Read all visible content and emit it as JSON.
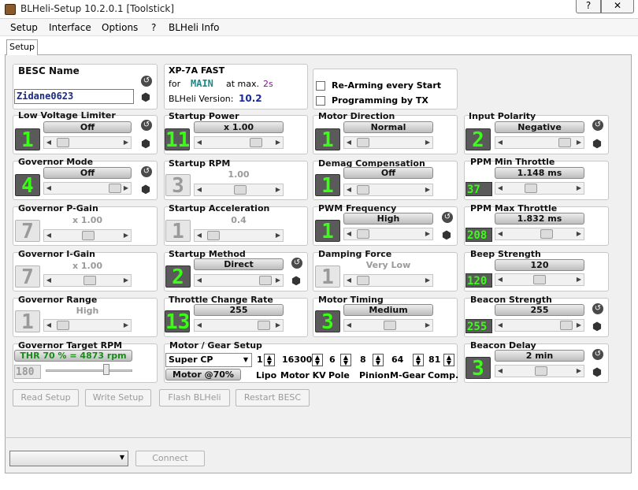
{
  "window": {
    "title": "BLHeli-Setup 10.2.0.1 [Toolstick]",
    "help": "?",
    "close": "✕"
  },
  "menu": [
    "Setup",
    "Interface",
    "Options",
    "?",
    "BLHeli Info"
  ],
  "tab": "Setup",
  "besc": {
    "label": "BESC Name",
    "value": "Zidane0623"
  },
  "info": {
    "line1": "XP-7A FAST",
    "for": "for",
    "main": "MAIN",
    "atmax": "at max.",
    "maxval": "2s",
    "version_label": "BLHeli Version:",
    "version": "10.2"
  },
  "rearm": {
    "label": "Re-Arming every Start"
  },
  "progtx": {
    "label": "Programming by TX"
  },
  "params": {
    "low_voltage": {
      "label": "Low Voltage Limiter",
      "num": "1",
      "value": "Off"
    },
    "startup_power": {
      "label": "Startup Power",
      "num": "11",
      "value": "x 1.00"
    },
    "motor_direction": {
      "label": "Motor Direction",
      "num": "1",
      "value": "Normal"
    },
    "input_polarity": {
      "label": "Input Polarity",
      "num": "2",
      "value": "Negative"
    },
    "governor_mode": {
      "label": "Governor Mode",
      "num": "4",
      "value": "Off"
    },
    "startup_rpm": {
      "label": "Startup RPM",
      "num": "3",
      "value": "1.00"
    },
    "demag": {
      "label": "Demag Compensation",
      "num": "1",
      "value": "Off"
    },
    "ppm_min": {
      "label": "PPM Min Throttle",
      "num": "37",
      "value": "1.148 ms"
    },
    "gov_p": {
      "label": "Governor P-Gain",
      "num": "7",
      "value": "x 1.00"
    },
    "startup_accel": {
      "label": "Startup Acceleration",
      "num": "1",
      "value": "0.4"
    },
    "pwm_freq": {
      "label": "PWM Frequency",
      "num": "1",
      "value": "High"
    },
    "ppm_max": {
      "label": "PPM Max Throttle",
      "num": "208",
      "value": "1.832 ms"
    },
    "gov_i": {
      "label": "Governor I-Gain",
      "num": "7",
      "value": "x 1.00"
    },
    "startup_method": {
      "label": "Startup Method",
      "num": "2",
      "value": "Direct"
    },
    "damping": {
      "label": "Damping Force",
      "num": "1",
      "value": "Very Low"
    },
    "beep": {
      "label": "Beep Strength",
      "num": "120",
      "value": "120"
    },
    "gov_range": {
      "label": "Governor Range",
      "num": "1",
      "value": "High"
    },
    "throttle_rate": {
      "label": "Throttle Change  Rate",
      "num": "13",
      "value": "255"
    },
    "motor_timing": {
      "label": "Motor Timing",
      "num": "3",
      "value": "Medium"
    },
    "beacon_strength": {
      "label": "Beacon Strength",
      "num": "255",
      "value": "255"
    },
    "gov_target": {
      "label": "Governor Target RPM",
      "value": "THR 70 % = 4873 rpm",
      "num": "180"
    },
    "beacon_delay": {
      "label": "Beacon Delay",
      "num": "3",
      "value": "2 min"
    }
  },
  "gear": {
    "label": "Motor / Gear Setup",
    "model": "Super CP",
    "motor_btn": "Motor @70%",
    "lipo": "1",
    "lipo_label": "Lipo",
    "kv": "16300",
    "kv_label": "Motor KV",
    "pole": "6",
    "pole_label": "Pole",
    "pinion": "8",
    "pinion_label": "Pinion",
    "mgear": "64",
    "mgear_label": "M-Gear",
    "comp": "81",
    "comp_label": "Comp."
  },
  "buttons": {
    "read": "Read Setup",
    "write": "Write Setup",
    "flash": "Flash BLHeli",
    "restart": "Restart BESC",
    "connect": "Connect"
  },
  "colors": {
    "lcd_green": "#39ff14",
    "gov_green": "#1a8a1a"
  }
}
